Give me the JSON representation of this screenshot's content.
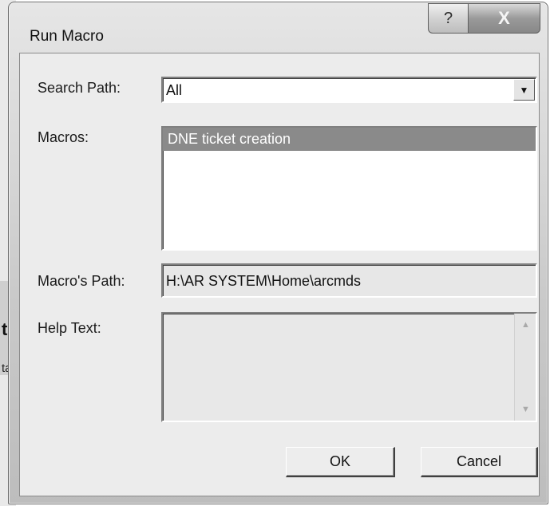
{
  "background": {
    "fragment_1": "t",
    "fragment_2": "ta"
  },
  "window": {
    "title": "Run Macro",
    "help_glyph": "?",
    "close_glyph": "X"
  },
  "form": {
    "search_path": {
      "label": "Search Path:",
      "value": "All"
    },
    "macros": {
      "label": "Macros:",
      "items": [
        "DNE ticket creation"
      ],
      "selected_index": 0
    },
    "macro_path": {
      "label": "Macro's Path:",
      "value": "H:\\AR SYSTEM\\Home\\arcmds"
    },
    "help_text": {
      "label": "Help Text:",
      "value": ""
    }
  },
  "buttons": {
    "ok_label": "OK",
    "cancel_label": "Cancel"
  },
  "icons": {
    "combo_arrow": "chevron-down-icon",
    "scroll_up": "scroll-up-icon",
    "scroll_down": "scroll-down-icon"
  }
}
